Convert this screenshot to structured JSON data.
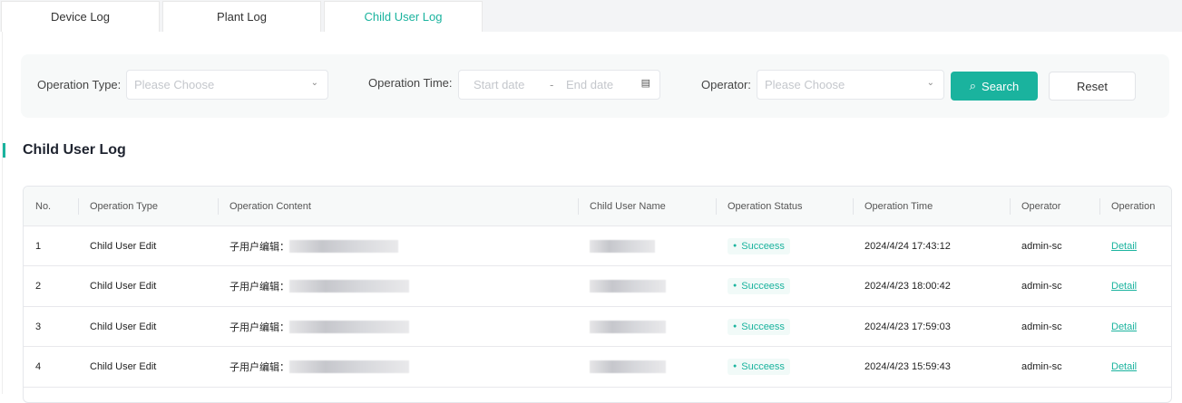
{
  "tabs": [
    {
      "label": "Device Log"
    },
    {
      "label": "Plant Log"
    },
    {
      "label": "Child User Log",
      "active": true
    }
  ],
  "filters": {
    "operation_type_label": "Operation Type:",
    "operation_type_placeholder": "Please Choose",
    "operation_time_label": "Operation Time:",
    "start_placeholder": "Start date",
    "range_sep": "-",
    "end_placeholder": "End date",
    "operator_label": "Operator:",
    "operator_placeholder": "Please Choose",
    "search_label": "Search",
    "reset_label": "Reset"
  },
  "section_title": "Child User Log",
  "table": {
    "columns": [
      "No.",
      "Operation Type",
      "Operation Content",
      "Child User Name",
      "Operation Status",
      "Operation Time",
      "Operator",
      "Operation"
    ],
    "rows": [
      {
        "no": "1",
        "type": "Child User Edit",
        "content": "子用户编辑：",
        "status": "Succeess",
        "time": "2024/4/24 17:43:12",
        "operator": "admin-sc",
        "action": "Detail"
      },
      {
        "no": "2",
        "type": "Child User Edit",
        "content": "子用户编辑：",
        "status": "Succeess",
        "time": "2024/4/23 18:00:42",
        "operator": "admin-sc",
        "action": "Detail"
      },
      {
        "no": "3",
        "type": "Child User Edit",
        "content": "子用户编辑：",
        "status": "Succeess",
        "time": "2024/4/23 17:59:03",
        "operator": "admin-sc",
        "action": "Detail"
      },
      {
        "no": "4",
        "type": "Child User Edit",
        "content": "子用户编辑：",
        "status": "Succeess",
        "time": "2024/4/23 15:59:43",
        "operator": "admin-sc",
        "action": "Detail"
      }
    ]
  },
  "colors": {
    "accent": "#1ab39e"
  }
}
